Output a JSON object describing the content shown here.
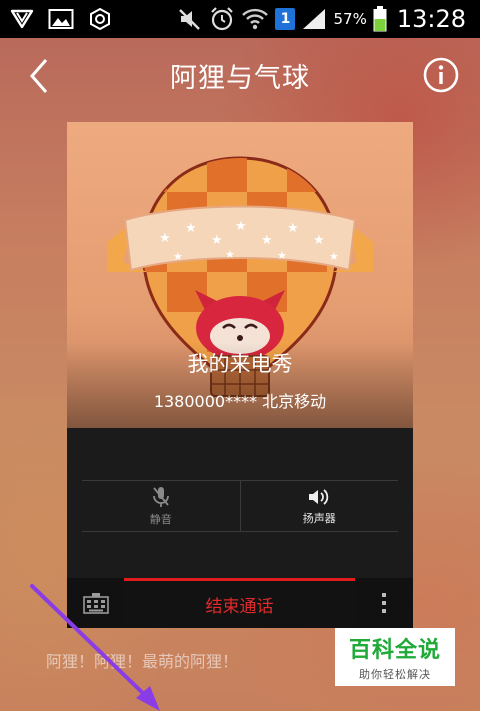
{
  "status_bar": {
    "left_icons": [
      "notification-v-icon",
      "gallery-icon",
      "hexagon-settings-icon"
    ],
    "right_icons": [
      "mute-icon",
      "alarm-icon",
      "wifi-icon",
      "sim-1-icon",
      "signal-icon",
      "battery-icon"
    ],
    "sim_label": "1",
    "battery_percent": "57%",
    "time": "13:28",
    "colors": {
      "background": "#000000",
      "battery": "#7bd23c",
      "sim": "#1e72d8"
    }
  },
  "header": {
    "title": "阿狸与气球",
    "back_icon": "chevron-left-icon",
    "info_icon": "info-circle-icon"
  },
  "card": {
    "show_title": "我的来电秀",
    "caller_line": "1380000**** 北京移动",
    "controls": {
      "mute_label": "静音",
      "speaker_label": "扬声器"
    },
    "bottom_bar": {
      "end_call_label": "结束通话",
      "keypad_icon": "dialpad-icon",
      "more_icon": "more-vertical-icon"
    },
    "colors": {
      "end_call": "#e22a2a",
      "panel": "#1b1b1b"
    }
  },
  "footer": {
    "caption": "阿狸！阿狸！最萌的阿狸！"
  },
  "watermark": {
    "title": "百科全说",
    "subtitle": "助你轻松解决"
  }
}
